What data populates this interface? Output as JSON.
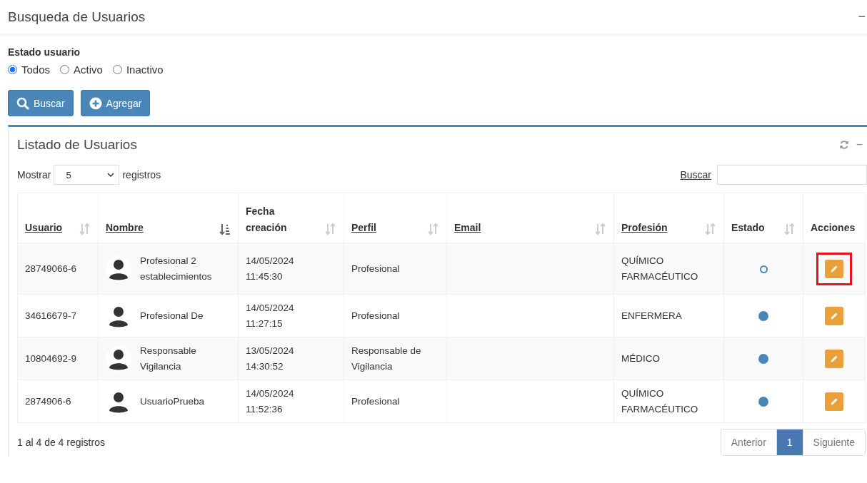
{
  "page_title": "Busqueda de Usuarios",
  "page_collapse": "−",
  "filter": {
    "label": "Estado usuario",
    "options": [
      {
        "label": "Todos",
        "selected": true
      },
      {
        "label": "Activo",
        "selected": false
      },
      {
        "label": "Inactivo",
        "selected": false
      }
    ]
  },
  "buttons": [
    {
      "kind": "search",
      "label": "Buscar"
    },
    {
      "kind": "add",
      "label": "Agregar"
    }
  ],
  "card": {
    "title": "Listado de Usuarios",
    "collapse": "−",
    "length_label_before": "Mostrar",
    "length_value": "5",
    "length_label_after": "registros",
    "search_label": "Buscar",
    "columns": [
      {
        "label": "Usuario",
        "link": true,
        "sortable": true,
        "sorted": false
      },
      {
        "label": "Nombre",
        "link": true,
        "sortable": true,
        "sorted": true
      },
      {
        "label": "Fecha creación",
        "link": false,
        "sortable": true,
        "sorted": false
      },
      {
        "label": "Perfil",
        "link": true,
        "sortable": true,
        "sorted": false
      },
      {
        "label": "Email",
        "link": true,
        "sortable": true,
        "sorted": false
      },
      {
        "label": "Profesión",
        "link": true,
        "sortable": true,
        "sorted": false
      },
      {
        "label": "Estado",
        "link": false,
        "sortable": true,
        "sorted": false
      },
      {
        "label": "Acciones",
        "link": false,
        "sortable": false
      }
    ],
    "rows": [
      {
        "usuario": "28749066-6",
        "nombre": "Profesional 2 establecimientos",
        "fecha": "14/05/2024",
        "hora": "11:45:30",
        "perfil": "Profesional",
        "profesion": "QUÍMICO FARMACÉUTICO",
        "active": false,
        "highlighted": true
      },
      {
        "usuario": "34616679-7",
        "nombre": "Profesional De",
        "fecha": "14/05/2024",
        "hora": "11:27:15",
        "perfil": "Profesional",
        "profesion": "ENFERMERA",
        "active": true,
        "highlighted": false
      },
      {
        "usuario": "10804692-9",
        "nombre": "Responsable Vigilancia",
        "fecha": "13/05/2024",
        "hora": "14:30:52",
        "perfil": "Responsable de Vigilancia",
        "profesion": "MÉDICO",
        "active": true,
        "highlighted": false
      },
      {
        "usuario": "2874906-6",
        "nombre": "UsuarioPrueba",
        "fecha": "14/05/2024",
        "hora": "11:52:36",
        "perfil": "Profesional",
        "profesion": "QUÍMICO FARMACÉUTICO",
        "active": true,
        "highlighted": false
      }
    ],
    "info": "1 al 4 de 4 registros",
    "pagination": [
      {
        "label": "Anterior",
        "selected": false
      },
      {
        "label": "1",
        "selected": true
      },
      {
        "label": "Siguiente",
        "selected": false
      }
    ]
  }
}
